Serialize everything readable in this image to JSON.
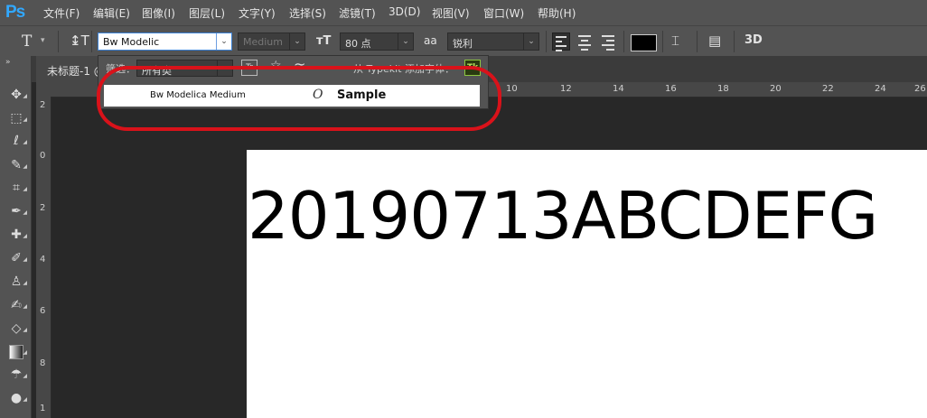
{
  "menubar": {
    "logo": "Ps",
    "items": [
      "文件(F)",
      "编辑(E)",
      "图像(I)",
      "图层(L)",
      "文字(Y)",
      "选择(S)",
      "滤镜(T)",
      "3D(D)",
      "视图(V)",
      "窗口(W)",
      "帮助(H)"
    ]
  },
  "options": {
    "tool_icon": "T",
    "font_family": "Bw Modelic",
    "font_style": "Medium",
    "font_size": "80 点",
    "anti_alias_icon": "aa",
    "anti_alias": "锐利",
    "text_color": "#000000",
    "three_d": "3D"
  },
  "document": {
    "tab_title": "未标题-1 @",
    "canvas_text": "20190713ABCDEFG"
  },
  "ruler": {
    "top_labels": [
      "10",
      "12",
      "14",
      "16",
      "18",
      "20",
      "22",
      "24",
      "26"
    ],
    "left_labels": [
      "2",
      "0",
      "2",
      "4",
      "6",
      "8",
      "1"
    ]
  },
  "font_panel": {
    "filter_label": "筛选：",
    "filter_value": "所有类",
    "typekit_label": "从 Typekit 添加字体：",
    "typekit_badge": "Tk",
    "results": [
      {
        "name": "Bw Modelica Medium",
        "type_icon": "O",
        "sample": "Sample"
      }
    ]
  },
  "colors": {
    "accent_blue": "#31a8ff",
    "highlight_red": "#d9121a",
    "panel_gray": "#535353"
  }
}
